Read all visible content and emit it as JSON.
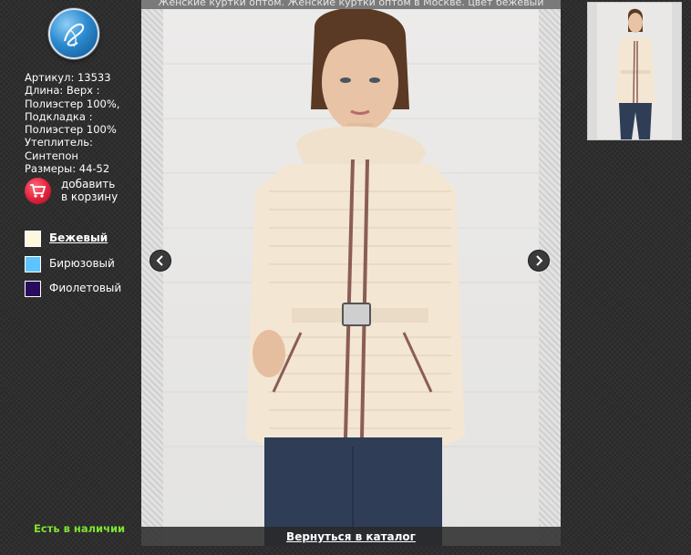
{
  "header": {
    "caption": "Женские куртки оптом. Женские куртки оптом в Москве. цвет бежевый"
  },
  "product": {
    "specs": [
      "Артикул: 13533",
      "Длина: Верх :",
      "Полиэстер 100%,",
      "Подкладка :",
      "Полиэстер 100%",
      "Утеплитель:",
      "Синтепон",
      "Размеры: 44-52"
    ],
    "cart_line1": "добавить",
    "cart_line2": "в корзину",
    "stock_status": "Есть в наличии"
  },
  "colors": [
    {
      "label": "Бежевый",
      "hex": "#fbf8df",
      "selected": true
    },
    {
      "label": "Бирюзовый",
      "hex": "#5ec4ff",
      "selected": false
    },
    {
      "label": "Фиолетовый",
      "hex": "#2a0a5c",
      "selected": false
    }
  ],
  "gallery": {
    "back_link": "Вернуться в каталог"
  },
  "theme": {
    "background": "#2e2e2e",
    "accent_green": "#7fe331",
    "cart_red": "#e0213a",
    "jacket_color": "#f3e6d3"
  }
}
